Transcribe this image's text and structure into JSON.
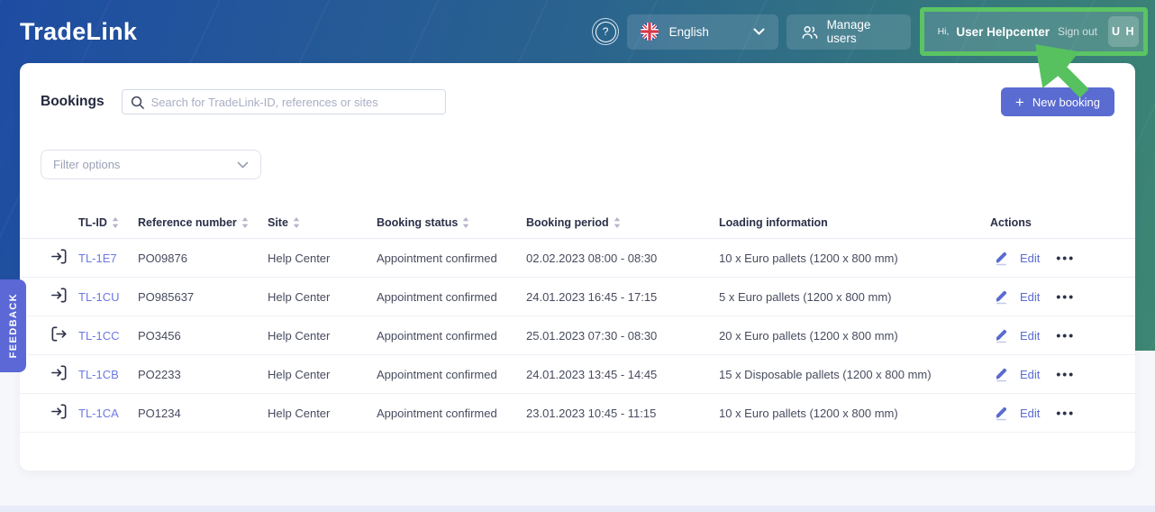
{
  "app": {
    "logo_text": "TradeLink"
  },
  "header": {
    "help_icon_glyph": "?",
    "language_selector": {
      "label": "English",
      "flag_icon": "uk-flag"
    },
    "manage_users": {
      "label": "Manage users"
    },
    "user_menu": {
      "greeting": "Hi,",
      "name": "User Helpcenter",
      "sign_out_label": "Sign out",
      "avatar_initials": "U H"
    }
  },
  "toolbar": {
    "page_title": "Bookings",
    "search_placeholder": "Search for TradeLink-ID, references or sites",
    "new_booking_label": "New booking",
    "plus_icon": "+"
  },
  "filters": {
    "label": "Filter options"
  },
  "feedback_tab": {
    "label": "FEEDBACK"
  },
  "table": {
    "columns": [
      {
        "label": "TL-ID",
        "sortable": true
      },
      {
        "label": "Reference number",
        "sortable": true
      },
      {
        "label": "Site",
        "sortable": true
      },
      {
        "label": "Booking status",
        "sortable": true
      },
      {
        "label": "Booking period",
        "sortable": true
      },
      {
        "label": "Loading information",
        "sortable": false
      },
      {
        "label": "Actions",
        "sortable": false
      }
    ],
    "actions": {
      "edit_label": "Edit",
      "more_icon": "•••"
    },
    "rows": [
      {
        "direction": "inbound",
        "tl_id": "TL-1E7",
        "reference_number": "PO09876",
        "site": "Help Center",
        "booking_status": "Appointment confirmed",
        "booking_period": "02.02.2023 08:00 - 08:30",
        "loading_information": "10 x Euro pallets (1200 x 800 mm)"
      },
      {
        "direction": "inbound",
        "tl_id": "TL-1CU",
        "reference_number": "PO985637",
        "site": "Help Center",
        "booking_status": "Appointment confirmed",
        "booking_period": "24.01.2023 16:45 - 17:15",
        "loading_information": "5 x Euro pallets (1200 x 800 mm)"
      },
      {
        "direction": "outbound",
        "tl_id": "TL-1CC",
        "reference_number": "PO3456",
        "site": "Help Center",
        "booking_status": "Appointment confirmed",
        "booking_period": "25.01.2023 07:30 - 08:30",
        "loading_information": "20 x Euro pallets (1200 x 800 mm)"
      },
      {
        "direction": "inbound",
        "tl_id": "TL-1CB",
        "reference_number": "PO2233",
        "site": "Help Center",
        "booking_status": "Appointment confirmed",
        "booking_period": "24.01.2023 13:45 - 14:45",
        "loading_information": "15 x Disposable pallets (1200 x 800 mm)"
      },
      {
        "direction": "inbound",
        "tl_id": "TL-1CA",
        "reference_number": "PO1234",
        "site": "Help Center",
        "booking_status": "Appointment confirmed",
        "booking_period": "23.01.2023 10:45 - 11:15",
        "loading_information": "10 x Euro pallets (1200 x 800 mm)"
      }
    ]
  },
  "colors": {
    "annotation_green": "#5bc463",
    "primary_button": "#5a6bd1",
    "link": "#6b79e3",
    "feedback_tab": "#5b68d6",
    "header_gradient_start": "#1e4ca3",
    "header_gradient_end": "#3d8673"
  }
}
